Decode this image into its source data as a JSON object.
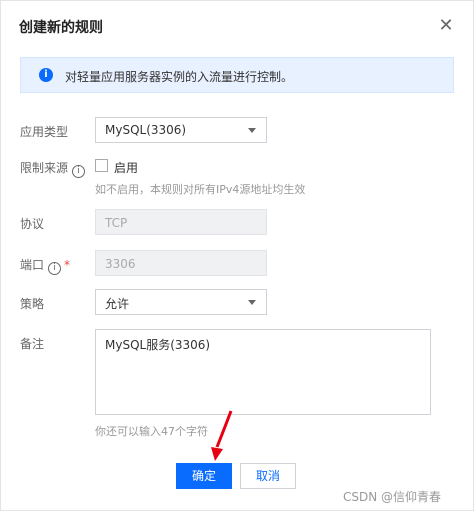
{
  "dialog": {
    "title": "创建新的规则",
    "close_icon": "close-icon",
    "notice": "对轻量应用服务器实例的入流量进行控制。",
    "notice_icon": "info-icon"
  },
  "form": {
    "app_type": {
      "label": "应用类型",
      "value": "MySQL(3306)"
    },
    "source": {
      "label": "限制来源",
      "checkbox_label": "启用",
      "hint": "如不启用，本规则对所有IPv4源地址均生效"
    },
    "protocol": {
      "label": "协议",
      "value": "TCP"
    },
    "port": {
      "label": "端口",
      "required_mark": "*",
      "value": "3306"
    },
    "policy": {
      "label": "策略",
      "value": "允许"
    },
    "remark": {
      "label": "备注",
      "value": "MySQL服务(3306)",
      "hint": "你还可以输入47个字符"
    }
  },
  "buttons": {
    "confirm": "确定",
    "cancel": "取消"
  },
  "annotation": {
    "arrow_color": "#e60012"
  },
  "watermark": "CSDN @信仰青春",
  "colors": {
    "primary": "#0a6bff",
    "notice_bg": "#e8f1ff"
  }
}
